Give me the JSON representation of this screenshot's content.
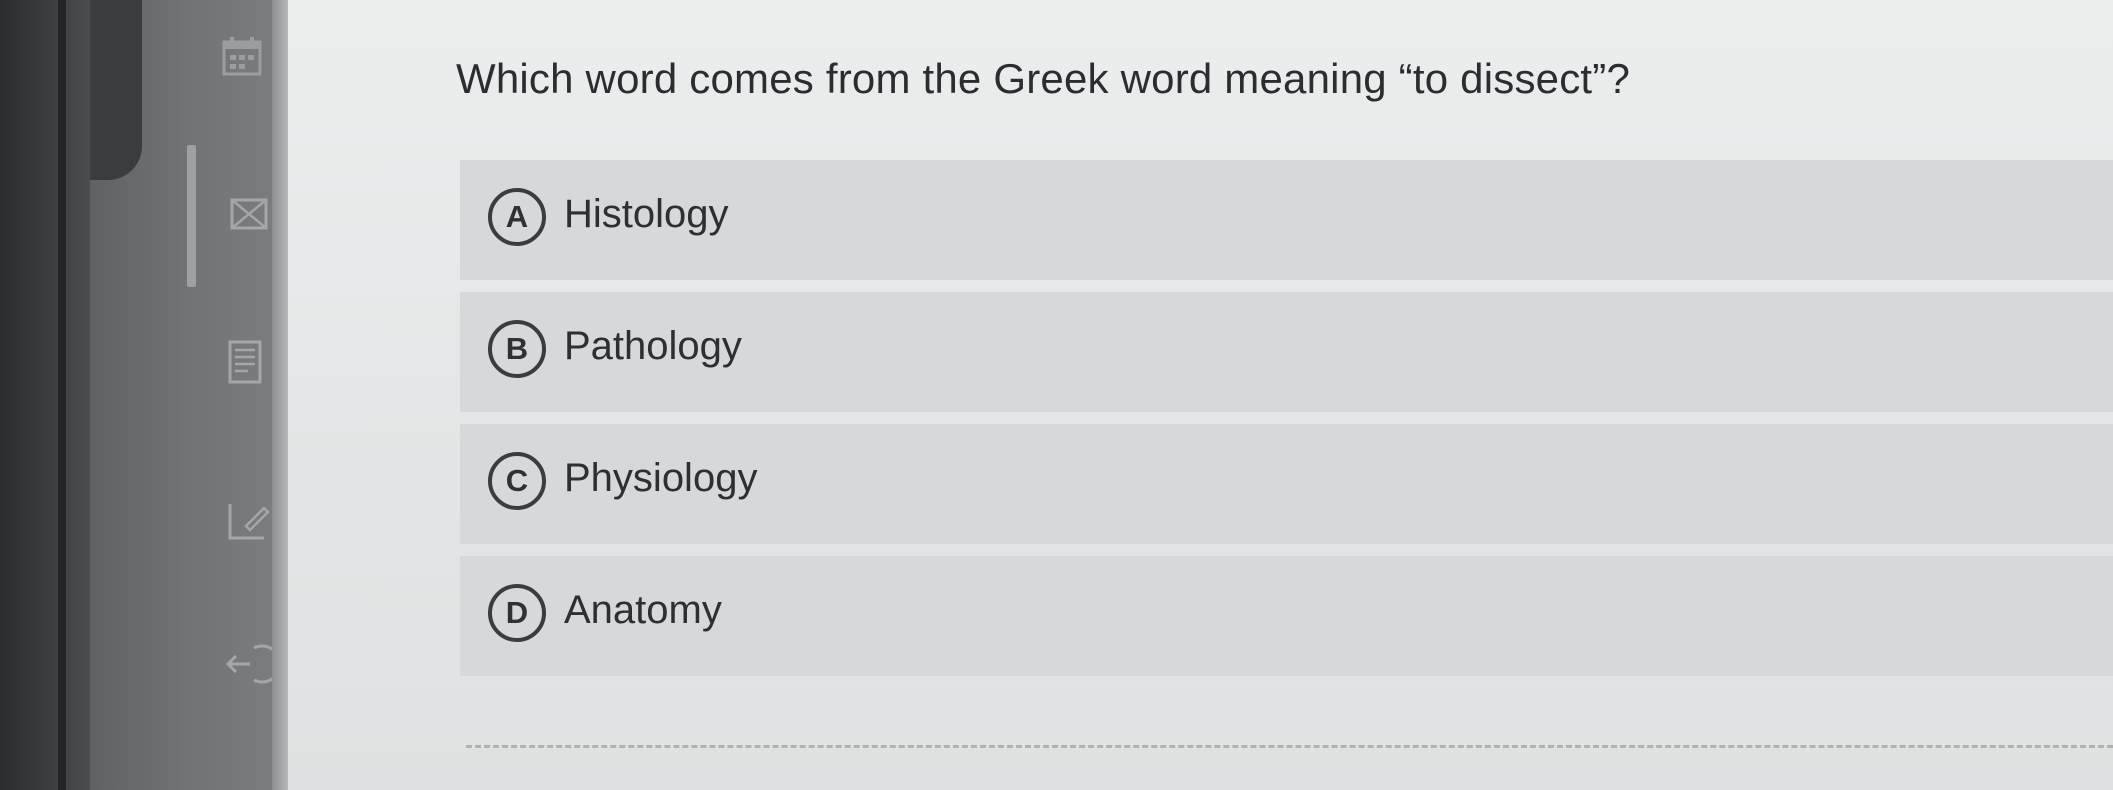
{
  "sidebar": {
    "icons": [
      {
        "name": "calendar-icon"
      },
      {
        "name": "mail-icon"
      },
      {
        "name": "document-list-icon"
      },
      {
        "name": "edit-icon"
      },
      {
        "name": "sign-out-icon"
      }
    ]
  },
  "quiz": {
    "question": "Which word comes from the Greek word meaning “to dissect”?",
    "options": [
      {
        "letter": "A",
        "label": "Histology"
      },
      {
        "letter": "B",
        "label": "Pathology"
      },
      {
        "letter": "C",
        "label": "Physiology"
      },
      {
        "letter": "D",
        "label": "Anatomy"
      }
    ]
  },
  "colors": {
    "option_background": "#d6d9d9",
    "content_background": "#e6e8e8",
    "text": "#2b2e30",
    "sidebar": "#6f7273"
  }
}
